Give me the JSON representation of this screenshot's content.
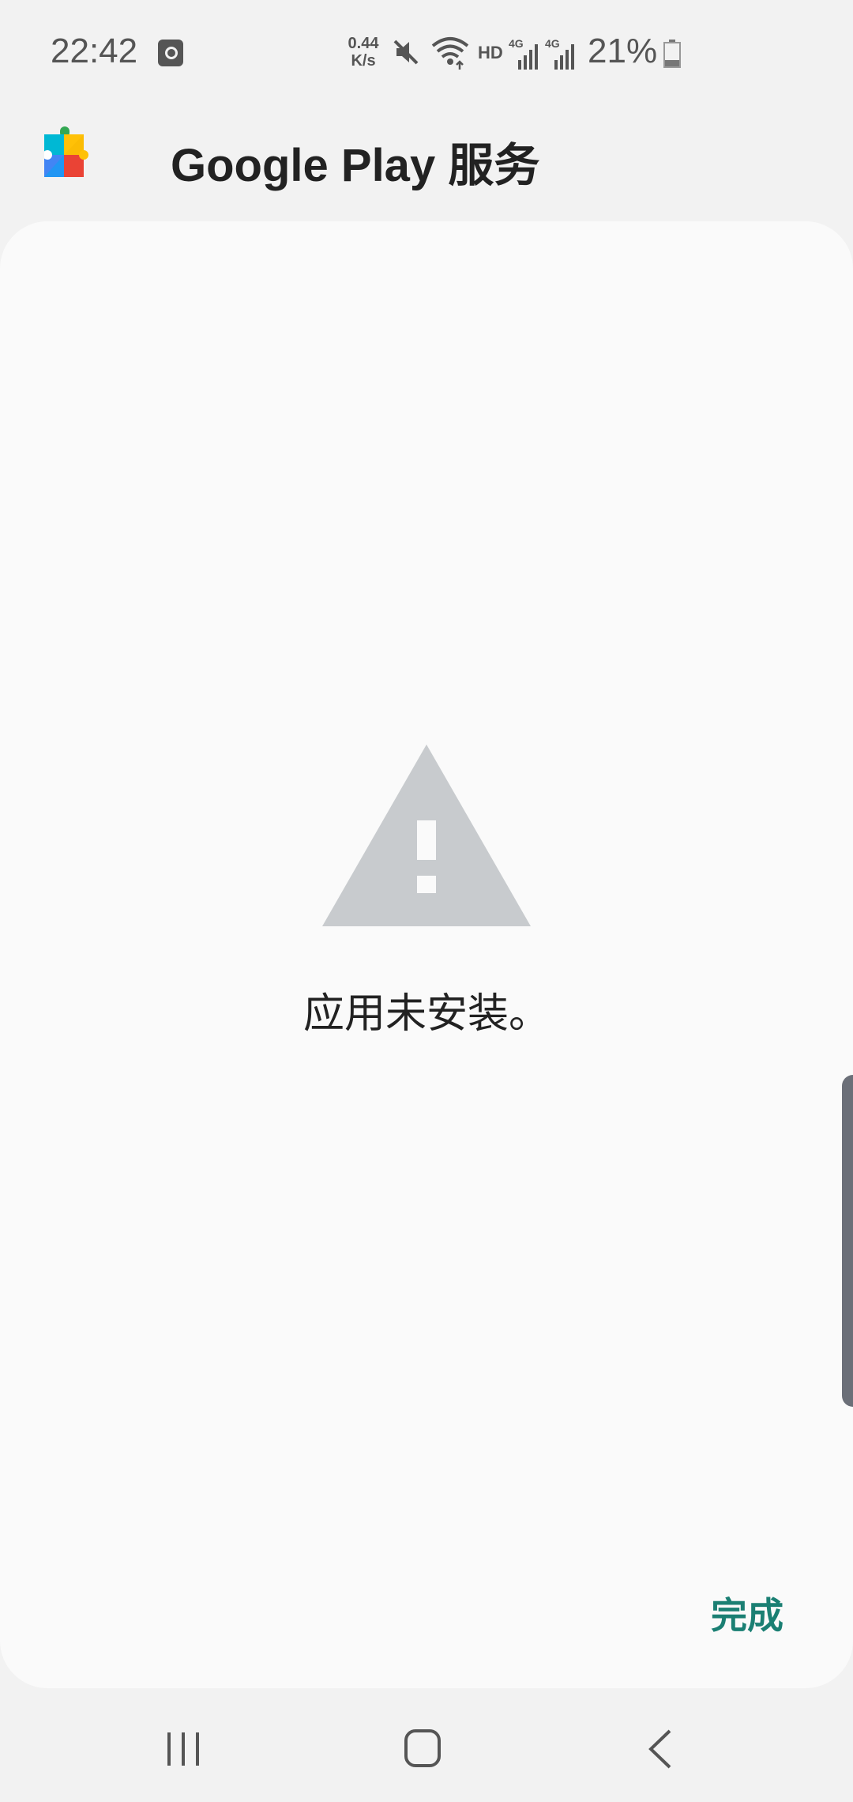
{
  "status_bar": {
    "time": "22:42",
    "net_speed_value": "0.44",
    "net_speed_unit": "K/s",
    "hd_label": "HD",
    "signal1_label": "4G",
    "signal2_label": "4G",
    "battery_percent": "21%"
  },
  "header": {
    "title": "Google Play 服务",
    "icon": "google-play-services-icon"
  },
  "dialog": {
    "icon": "warning-icon",
    "message": "应用未安装。",
    "done_label": "完成"
  },
  "nav": {
    "recent": "recent-apps-icon",
    "home": "home-icon",
    "back": "back-icon"
  },
  "colors": {
    "accent": "#1a7f73",
    "warning_icon": "#c8cbce",
    "card_background": "#fafafa",
    "page_background": "#f2f2f2"
  }
}
